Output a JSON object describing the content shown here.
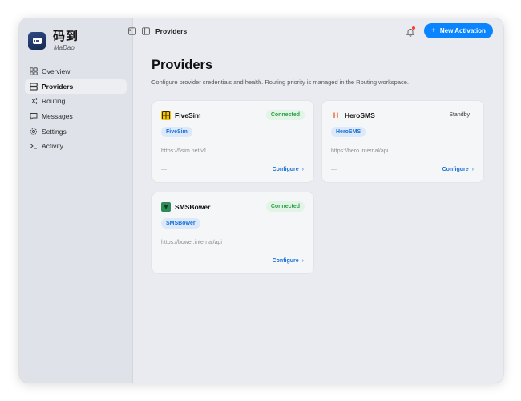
{
  "app": {
    "name": "码到",
    "subtitle": "MaDao"
  },
  "sidebar": {
    "items": [
      {
        "label": "Overview",
        "icon": "grid-icon",
        "active": false
      },
      {
        "label": "Providers",
        "icon": "server-icon",
        "active": true
      },
      {
        "label": "Routing",
        "icon": "shuffle-icon",
        "active": false
      },
      {
        "label": "Messages",
        "icon": "message-icon",
        "active": false
      },
      {
        "label": "Settings",
        "icon": "gear-icon",
        "active": false
      },
      {
        "label": "Activity",
        "icon": "terminal-icon",
        "active": false
      }
    ]
  },
  "topbar": {
    "title": "Providers",
    "new_button_label": "New Activation",
    "new_button_icon": "+"
  },
  "page": {
    "title": "Providers",
    "subtitle": "Configure provider credentials and health. Routing priority is managed in the Routing workspace."
  },
  "providers": [
    {
      "name": "FiveSim",
      "status": "Connected",
      "tag": "FiveSim",
      "url": "https://5sim.net/v1",
      "footer": "—",
      "action": "Configure",
      "logo_color": "#f5c400"
    },
    {
      "name": "HeroSMS",
      "status": "Standby",
      "tag": "HeroSMS",
      "url": "https://hero.internal/api",
      "footer": "—",
      "action": "Configure",
      "logo_color": "#e8622c"
    },
    {
      "name": "SMSBower",
      "status": "Connected",
      "tag": "SMSBower",
      "url": "https://bower.internal/api",
      "footer": "—",
      "action": "Configure",
      "logo_color": "#2e8b57"
    }
  ],
  "colors": {
    "accent": "#0a84ff",
    "connected": "#2a9d47",
    "badge_bg": "#dbe9fb"
  }
}
